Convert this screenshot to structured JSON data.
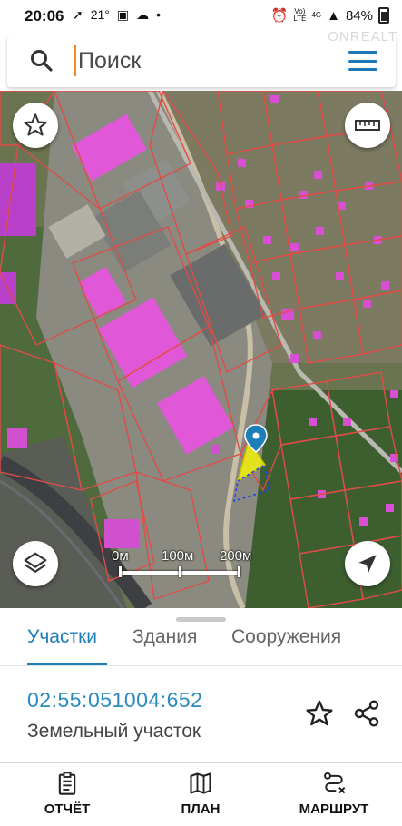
{
  "status_bar": {
    "time": "20:06",
    "temperature": "21°",
    "network_top": "Vo)",
    "network_mid": "LTE",
    "network_gen": "4G",
    "battery": "84%"
  },
  "search": {
    "placeholder": "Поиск"
  },
  "watermark": "ONREALT",
  "map": {
    "scale": {
      "labels": [
        "0м",
        "100м",
        "200м"
      ]
    }
  },
  "sheet": {
    "tabs": [
      {
        "label": "Участки",
        "active": true
      },
      {
        "label": "Здания",
        "active": false
      },
      {
        "label": "Сооружения",
        "active": false
      }
    ],
    "parcel": {
      "cadastral_number": "02:55:051004:652",
      "type": "Земельный участок"
    }
  },
  "bottom_nav": {
    "items": [
      {
        "label": "ОТЧЁТ",
        "icon": "report-icon"
      },
      {
        "label": "ПЛАН",
        "icon": "map-plan-icon"
      },
      {
        "label": "МАРШРУТ",
        "icon": "route-icon"
      }
    ]
  },
  "colors": {
    "accent": "#1e7fb8",
    "parcel_outline": "#e04c48",
    "building_highlight": "#e058d8",
    "selected_parcel": "#f2f20a",
    "caret": "#f08a1c"
  }
}
